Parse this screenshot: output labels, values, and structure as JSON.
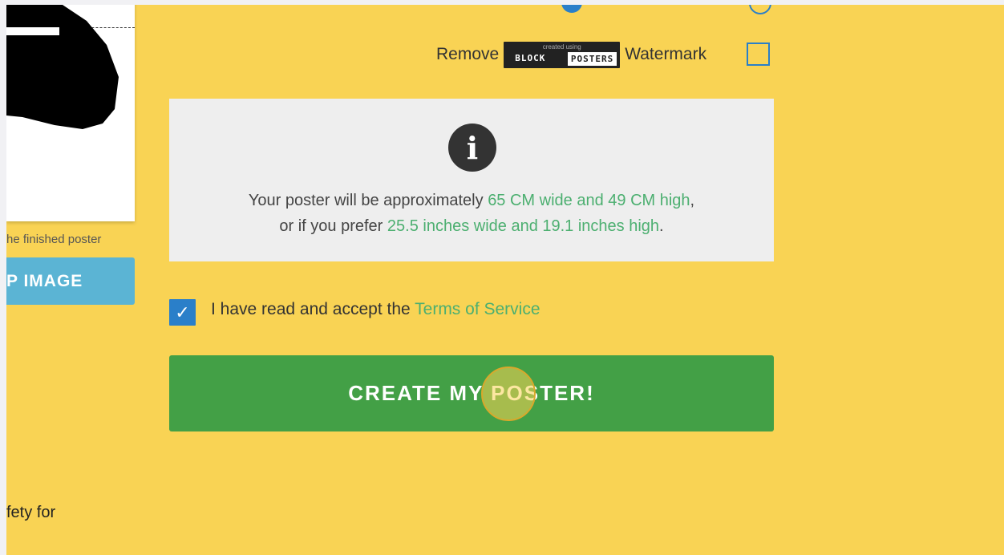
{
  "preview": {
    "caption": "he finished poster",
    "crop_button_label": "P IMAGE"
  },
  "footer_partial": {
    "text": "fety for"
  },
  "watermark": {
    "remove_label": "Remove",
    "badge_small": "created using",
    "badge_block": "BLOCK",
    "badge_posters": "POSTERS",
    "watermark_label": "Watermark",
    "checked": false
  },
  "info": {
    "line1_prefix": "Your poster will be approximately ",
    "line1_highlight": "65 CM wide and 49 CM high",
    "line1_suffix": ",",
    "line2_prefix": "or if you prefer ",
    "line2_highlight": "25.5 inches wide and 19.1 inches high",
    "line2_suffix": "."
  },
  "terms": {
    "checked": true,
    "prefix": "I have read and accept the ",
    "link": "Terms of Service"
  },
  "create_button": {
    "label": "CREATE MY POSTER!"
  },
  "colors": {
    "background": "#f9d354",
    "accent_blue": "#2a7fc9",
    "link_green": "#4caf70",
    "button_green": "#43a046",
    "crop_blue": "#5bb4d4"
  }
}
